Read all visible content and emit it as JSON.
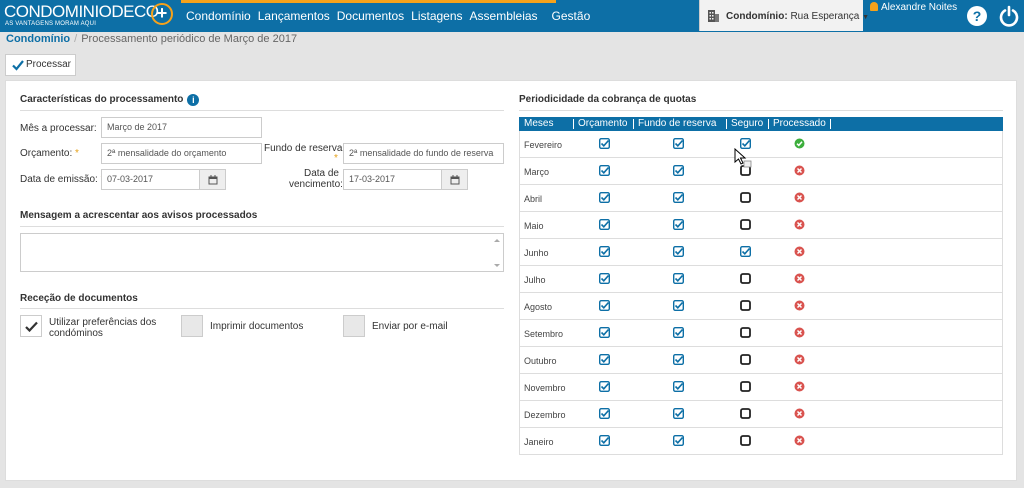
{
  "header": {
    "logo_main": "CONDOMINIODECO",
    "logo_sub": "AS VANTAGENS MORAM AQUI",
    "logo_plus": "+",
    "nav": [
      "Condomínio",
      "Lançamentos",
      "Documentos",
      "Listagens",
      "Assembleias",
      "Gestão"
    ],
    "condo_label": "Condomínio:",
    "condo_value": "Rua Esperança",
    "user_name": "Alexandre Noites",
    "help_label": "?"
  },
  "breadcrumb": {
    "root": "Condomínio",
    "current": "Processamento periódico de Março de 2017"
  },
  "toolbar": {
    "process_label": "Processar"
  },
  "form": {
    "title": "Características do processamento",
    "info_icon": "i",
    "mes_label": "Mês a processar:",
    "mes_value": "Março de 2017",
    "orcamento_label": "Orçamento:",
    "orcamento_value": "2ª mensalidade do orçamento",
    "fundo_label": "Fundo de reserva:",
    "fundo_value": "2ª mensalidade do fundo de reserva",
    "emissao_label": "Data de emissão:",
    "emissao_value": "07-03-2017",
    "vencimento_label_1": "Data de",
    "vencimento_label_2": "vencimento:",
    "vencimento_value": "17-03-2017",
    "required_mark": "*",
    "mensagem_title": "Mensagem a acrescentar aos avisos processados",
    "rececao_title": "Receção de documentos",
    "opt_preferencias_1": "Utilizar preferências dos",
    "opt_preferencias_2": "condóminos",
    "opt_imprimir": "Imprimir documentos",
    "opt_email": "Enviar por e-mail"
  },
  "periodicity": {
    "title": "Periodicidade da cobrança de quotas",
    "columns": [
      "Meses",
      "Orçamento",
      "Fundo de reserva",
      "Seguro",
      "Processado"
    ],
    "rows": [
      {
        "month": "Fevereiro",
        "orcamento": true,
        "fundo": true,
        "seguro": true,
        "processado": true
      },
      {
        "month": "Março",
        "orcamento": true,
        "fundo": true,
        "seguro": false,
        "processado": false
      },
      {
        "month": "Abril",
        "orcamento": true,
        "fundo": true,
        "seguro": false,
        "processado": false
      },
      {
        "month": "Maio",
        "orcamento": true,
        "fundo": true,
        "seguro": false,
        "processado": false
      },
      {
        "month": "Junho",
        "orcamento": true,
        "fundo": true,
        "seguro": true,
        "processado": false
      },
      {
        "month": "Julho",
        "orcamento": true,
        "fundo": true,
        "seguro": false,
        "processado": false
      },
      {
        "month": "Agosto",
        "orcamento": true,
        "fundo": true,
        "seguro": false,
        "processado": false
      },
      {
        "month": "Setembro",
        "orcamento": true,
        "fundo": true,
        "seguro": false,
        "processado": false
      },
      {
        "month": "Outubro",
        "orcamento": true,
        "fundo": true,
        "seguro": false,
        "processado": false
      },
      {
        "month": "Novembro",
        "orcamento": true,
        "fundo": true,
        "seguro": false,
        "processado": false
      },
      {
        "month": "Dezembro",
        "orcamento": true,
        "fundo": true,
        "seguro": false,
        "processado": false
      },
      {
        "month": "Janeiro",
        "orcamento": true,
        "fundo": true,
        "seguro": false,
        "processado": false
      }
    ]
  },
  "colors": {
    "brand_blue": "#0d6fa6",
    "accent_orange": "#f5a21b",
    "ok_green": "#3cae3c",
    "no_red": "#d9534f"
  }
}
